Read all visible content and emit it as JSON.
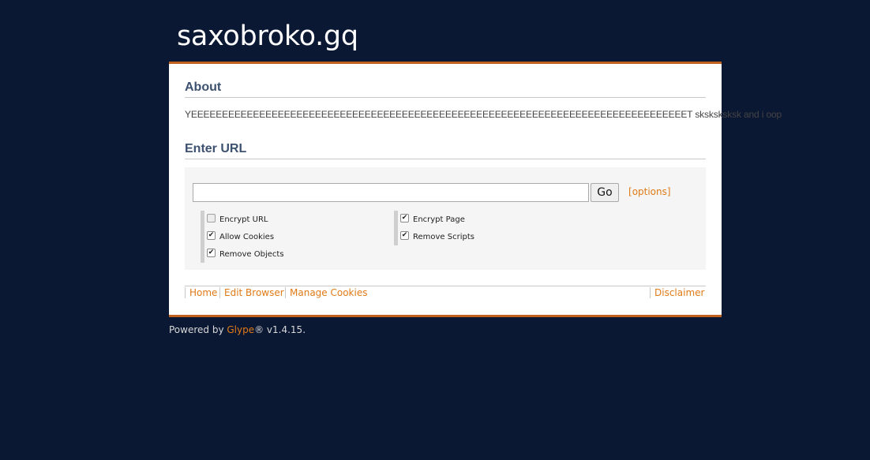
{
  "site": {
    "title": "saxobroko.gq"
  },
  "about": {
    "heading": "About",
    "text": "YEEEEEEEEEEEEEEEEEEEEEEEEEEEEEEEEEEEEEEEEEEEEEEEEEEEEEEEEEEEEEEEEEEEEEEEEEEEEEEEET sksksksksk and i oop"
  },
  "url_form": {
    "heading": "Enter URL",
    "input_value": "",
    "go_label": "Go",
    "bracket_open": "[",
    "options_label": "options",
    "bracket_close": "]"
  },
  "options": {
    "encrypt_url": {
      "label": "Encrypt URL",
      "checked": false
    },
    "allow_cookies": {
      "label": "Allow Cookies",
      "checked": true
    },
    "remove_objects": {
      "label": "Remove Objects",
      "checked": true
    },
    "encrypt_page": {
      "label": "Encrypt Page",
      "checked": true
    },
    "remove_scripts": {
      "label": "Remove Scripts",
      "checked": true
    }
  },
  "nav": {
    "home": "Home",
    "edit_browser": "Edit Browser",
    "manage_cookies": "Manage Cookies",
    "disclaimer": "Disclaimer"
  },
  "footer": {
    "prefix": "Powered by ",
    "link": "Glype",
    "suffix": "® v1.4.15."
  },
  "colors": {
    "background": "#0b1834",
    "accent": "#c0621b",
    "link": "#e07a17",
    "heading": "#3d5170"
  }
}
